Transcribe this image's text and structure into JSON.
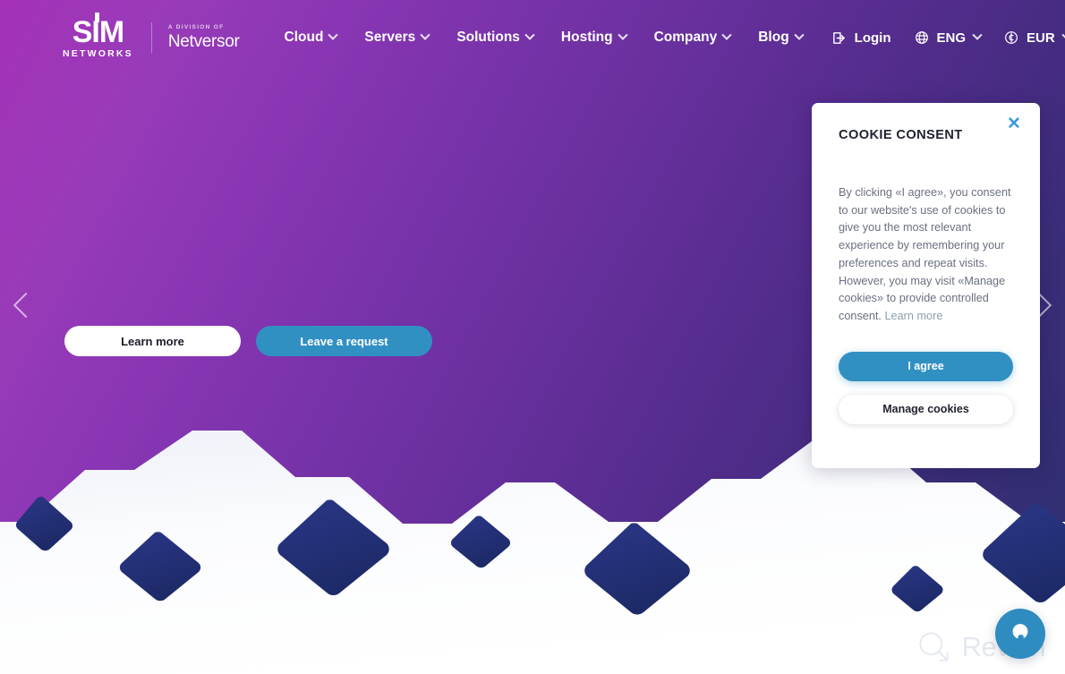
{
  "brand": {
    "logo_mark": "SIM",
    "logo_name": "NETWORKS",
    "division_label": "A DIVISION OF",
    "division_name": "Netversor"
  },
  "nav": {
    "items": [
      {
        "label": "Cloud",
        "icon": "chevron-down-icon"
      },
      {
        "label": "Servers",
        "icon": "chevron-down-icon"
      },
      {
        "label": "Solutions",
        "icon": "chevron-down-icon"
      },
      {
        "label": "Hosting",
        "icon": "chevron-down-icon"
      },
      {
        "label": "Company",
        "icon": "chevron-down-icon"
      },
      {
        "label": "Blog",
        "icon": "chevron-down-icon"
      }
    ]
  },
  "header_right": {
    "login": {
      "label": "Login",
      "icon": "login-icon"
    },
    "language": {
      "label": "ENG",
      "icon": "globe-icon",
      "chevron": "chevron-down-icon"
    },
    "currency": {
      "label": "EUR",
      "icon": "currency-icon",
      "chevron": "chevron-down-icon"
    }
  },
  "hero": {
    "primary_cta": "Learn more",
    "secondary_cta": "Leave a request",
    "prev_arrow": "chevron-left-icon",
    "next_arrow": "chevron-right-icon"
  },
  "cookie": {
    "close_icon": "close-icon",
    "title": "COOKIE CONSENT",
    "body": "By clicking «I agree», you consent to our website's use of cookies to give you the most relevant experience by remembering your preferences and repeat visits. However, you may visit «Manage cookies» to provide controlled consent.",
    "learn_more": "Learn more",
    "agree_label": "I agree",
    "manage_label": "Manage cookies"
  },
  "chat": {
    "icon": "chat-bubble-icon"
  },
  "watermark": {
    "icon": "revain-logo-icon",
    "text": "Revain"
  },
  "colors": {
    "gradient_start": "#a431b8",
    "gradient_end": "#2c3070",
    "accent_blue": "#3190c2",
    "diamond_navy": "#26327e",
    "diamond_navy_dark": "#1f2d6e",
    "link_grey": "#8fa0ae",
    "body_text": "#6a7080"
  }
}
